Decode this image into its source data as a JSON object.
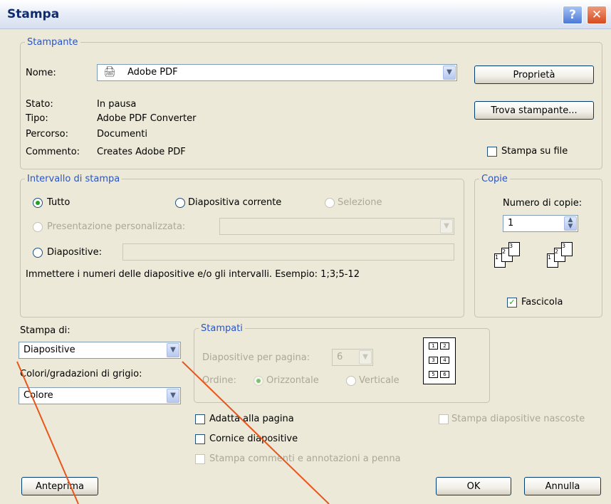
{
  "window": {
    "title": "Stampa"
  },
  "printer": {
    "legend": "Stampante",
    "name_label": "Nome:",
    "name_value": "Adobe PDF",
    "status_label": "Stato:",
    "status_value": "In pausa",
    "type_label": "Tipo:",
    "type_value": "Adobe PDF Converter",
    "path_label": "Percorso:",
    "path_value": "Documenti",
    "comment_label": "Commento:",
    "comment_value": "Creates Adobe PDF",
    "properties_button": "Proprietà",
    "find_button": "Trova stampante...",
    "print_to_file": "Stampa su file"
  },
  "range": {
    "legend": "Intervallo di stampa",
    "all": "Tutto",
    "current": "Diapositiva corrente",
    "selection": "Selezione",
    "custom_show": "Presentazione personalizzata:",
    "slides": "Diapositive:",
    "hint": "Immettere i numeri delle diapositive e/o gli intervalli. Esempio: 1;3;5-12"
  },
  "copies": {
    "legend": "Copie",
    "count_label": "Numero di copie:",
    "count_value": "1",
    "collate": "Fascicola"
  },
  "print_what": {
    "label": "Stampa di:",
    "value": "Diapositive",
    "color_label": "Colori/gradazioni di grigio:",
    "color_value": "Colore"
  },
  "handouts": {
    "legend": "Stampati",
    "per_page_label": "Diapositive per pagina:",
    "per_page_value": "6",
    "order_label": "Ordine:",
    "horizontal": "Orizzontale",
    "vertical": "Verticale",
    "cells": [
      "1",
      "2",
      "3",
      "4",
      "5",
      "6"
    ]
  },
  "options": {
    "fit": "Adatta alla pagina",
    "frame": "Cornice diapositive",
    "comments": "Stampa commenti e annotazioni a penna",
    "hidden": "Stampa diapositive nascoste"
  },
  "buttons": {
    "preview": "Anteprima",
    "ok": "OK",
    "cancel": "Annulla"
  },
  "annotation_color": "#e8561c"
}
